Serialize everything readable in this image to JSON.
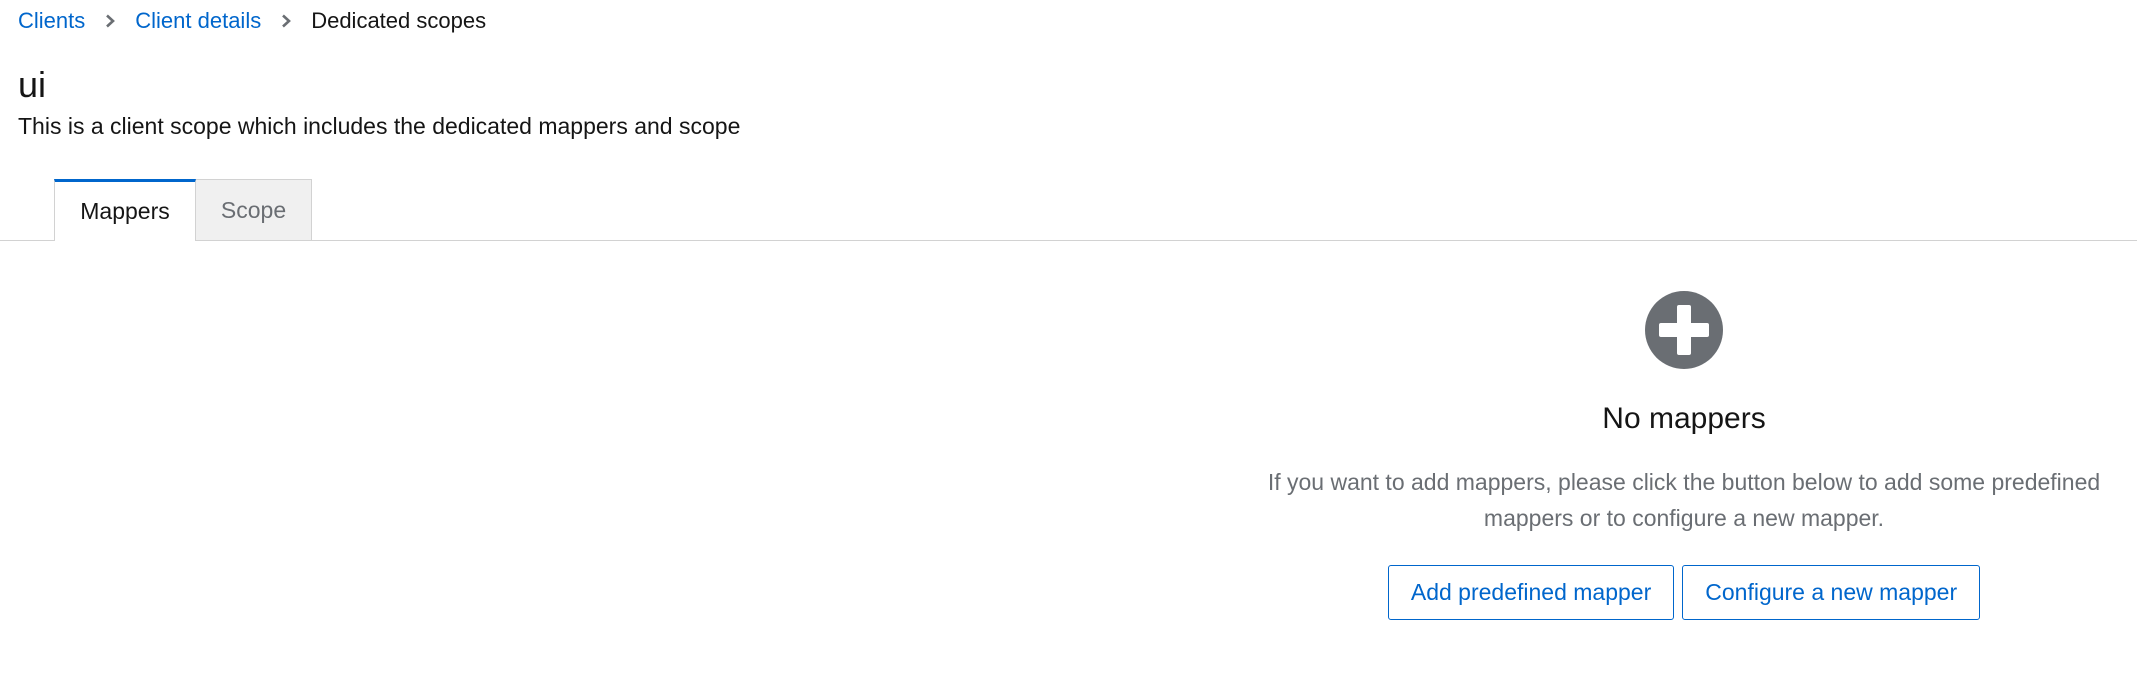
{
  "breadcrumb": {
    "items": [
      {
        "label": "Clients"
      },
      {
        "label": "Client details"
      },
      {
        "label": "Dedicated scopes"
      }
    ]
  },
  "header": {
    "title": "ui",
    "description": "This is a client scope which includes the dedicated mappers and scope"
  },
  "tabs": [
    {
      "label": "Mappers",
      "selected": true
    },
    {
      "label": "Scope",
      "selected": false
    }
  ],
  "empty_state": {
    "icon": "plus-circle-icon",
    "title": "No mappers",
    "body": "If you want to add mappers, please click the button below to add some predefined mappers or to configure a new mapper.",
    "primary_action": "Add predefined mapper",
    "secondary_action": "Configure a new mapper"
  },
  "colors": {
    "link": "#0066cc",
    "text": "#151515",
    "muted": "#6a6e73",
    "icon": "#6a6e73",
    "tab_inactive_bg": "#f0f0f0",
    "border": "#d2d2d2"
  }
}
